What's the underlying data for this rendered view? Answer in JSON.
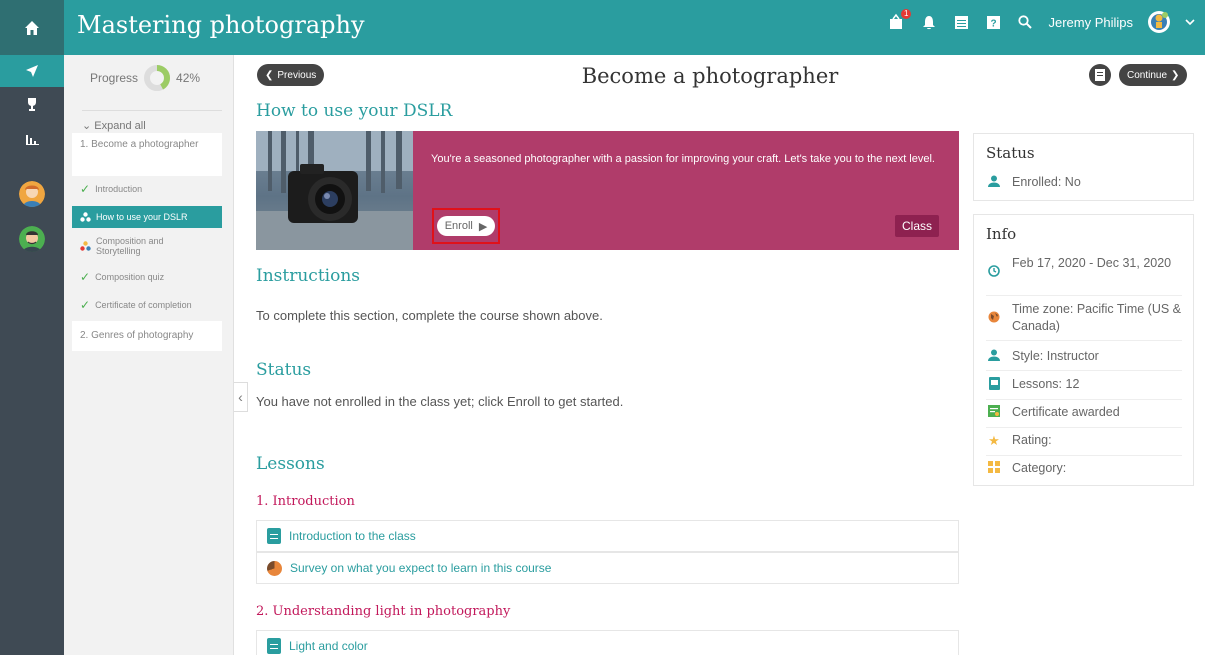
{
  "header": {
    "app_title": "Mastering photography",
    "user_name": "Jeremy Philips",
    "notification_count": "1",
    "icons": [
      "home-icon",
      "notifications-icon",
      "bell-icon",
      "calendar-icon",
      "help-icon",
      "search-icon",
      "user-avatar-icon",
      "chevron-down-icon"
    ]
  },
  "rail": {
    "icons": [
      "compass-icon",
      "trophy-icon",
      "chart-icon",
      "avatar-1",
      "avatar-2"
    ]
  },
  "outline": {
    "progress_label": "Progress",
    "progress_percent": "42%",
    "progress_value": 0.42,
    "expand_all": "Expand all",
    "section1": "1. Become a photographer",
    "items": [
      {
        "label": "Introduction",
        "state": "done"
      },
      {
        "label": "How to use your DSLR",
        "state": "active"
      },
      {
        "label": "Composition and Storytelling",
        "state": "pending"
      },
      {
        "label": "Composition quiz",
        "state": "done"
      },
      {
        "label": "Certificate of completion",
        "state": "done"
      }
    ],
    "section2": "2. Genres of photography"
  },
  "nav": {
    "previous": "Previous",
    "page_title": "Become a photographer",
    "continue": "Continue"
  },
  "main": {
    "heading": "How to use your DSLR",
    "card_text": "You're a seasoned photographer with a passion for improving your craft. Let's take you to the next level.",
    "enroll": "Enroll",
    "class_tag": "Class",
    "instructions_title": "Instructions",
    "instructions_text": "To complete this section, complete the course shown above.",
    "status_title": "Status",
    "status_text": "You have not enrolled in the class yet; click Enroll to get started.",
    "lessons_title": "Lessons",
    "lesson_group1": "1. Introduction",
    "lesson1": "Introduction to the class",
    "lesson2": "Survey on what you expect to learn in this course",
    "lesson_group2": "2. Understanding light in photography",
    "lesson3": "Light and color"
  },
  "status_panel": {
    "title": "Status",
    "enrolled": "Enrolled: No"
  },
  "info_panel": {
    "title": "Info",
    "dates": "Feb 17, 2020 - Dec 31, 2020",
    "timezone": "Time zone: Pacific Time (US & Canada)",
    "style": "Style: Instructor",
    "lessons": "Lessons: 12",
    "certificate": "Certificate awarded",
    "rating": "Rating:",
    "category": "Category:"
  },
  "colors": {
    "teal": "#2a9d9f",
    "rail": "#3f4a54",
    "card": "#b03c6a",
    "highlight": "#e0111a"
  }
}
